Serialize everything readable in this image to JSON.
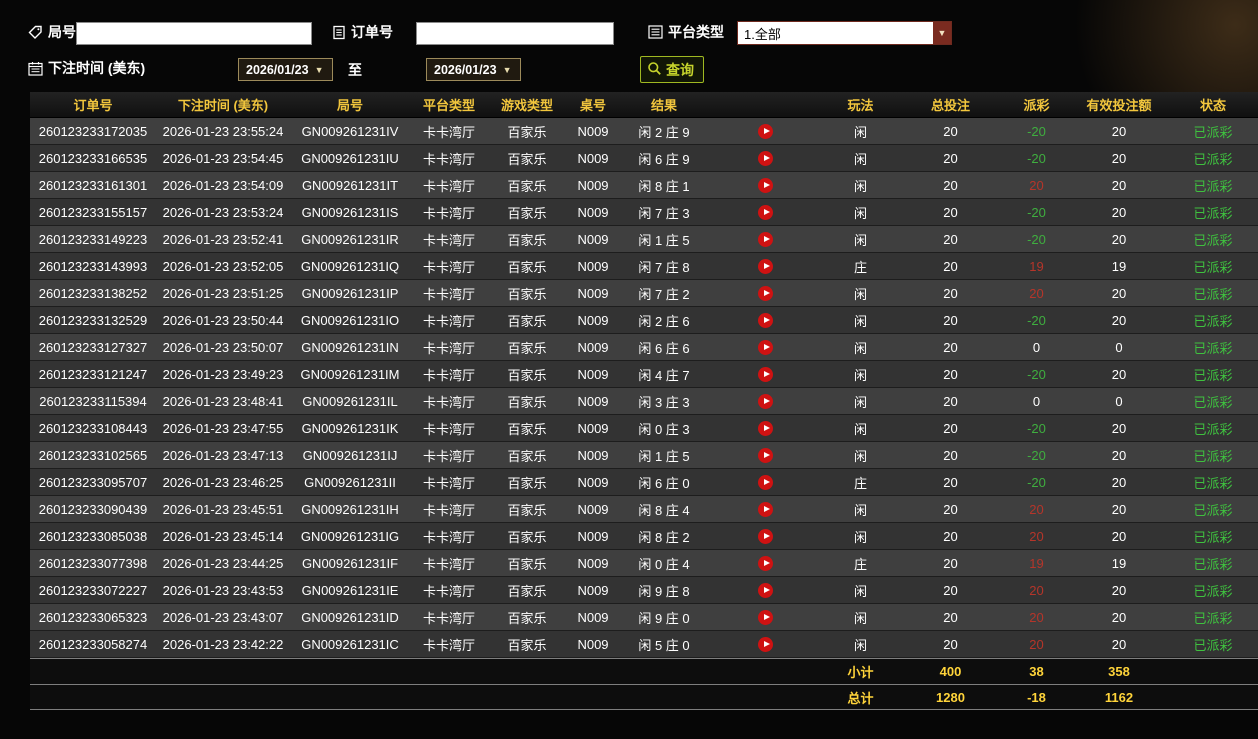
{
  "colors": {
    "header_text": "#f2c63d",
    "payout_win": "#b5352a",
    "payout_loss": "#3fae3f",
    "status_paid": "#3fc13f",
    "totals_text": "#ffd43a",
    "play_button": "#cf1212",
    "query_accent": "#c6d42c"
  },
  "icons": {
    "round": "tag-icon",
    "order": "document-icon",
    "platform": "list-icon",
    "bet_time": "calendar-icon",
    "query": "search-icon",
    "replay": "play-icon",
    "dropdown": "chevron-down-icon"
  },
  "filters": {
    "round": {
      "label": "局号",
      "value": ""
    },
    "order": {
      "label": "订单号",
      "value": ""
    },
    "platform": {
      "label": "平台类型",
      "value": "1.全部"
    },
    "bet_time": {
      "label": "下注时间 (美东)",
      "from": "2026/01/23",
      "to_label": "至",
      "to": "2026/01/23"
    },
    "query_label": "查询"
  },
  "table": {
    "headers": [
      "订单号",
      "下注时间 (美东)",
      "局号",
      "平台类型",
      "游戏类型",
      "桌号",
      "结果",
      "",
      "玩法",
      "总投注",
      "派彩",
      "有效投注额",
      "状态"
    ],
    "rows": [
      {
        "order_id": "260123233172035",
        "bet_time": "2026-01-23 23:55:24",
        "round": "GN009261231IV",
        "platform": "卡卡湾厅",
        "game": "百家乐",
        "table_no": "N009",
        "result": "闲 2 庄 9",
        "play": "闲",
        "total_bet": "20",
        "payout": "-20",
        "payout_class": "neg",
        "valid_bet": "20",
        "status": "已派彩"
      },
      {
        "order_id": "260123233166535",
        "bet_time": "2026-01-23 23:54:45",
        "round": "GN009261231IU",
        "platform": "卡卡湾厅",
        "game": "百家乐",
        "table_no": "N009",
        "result": "闲 6 庄 9",
        "play": "闲",
        "total_bet": "20",
        "payout": "-20",
        "payout_class": "neg",
        "valid_bet": "20",
        "status": "已派彩"
      },
      {
        "order_id": "260123233161301",
        "bet_time": "2026-01-23 23:54:09",
        "round": "GN009261231IT",
        "platform": "卡卡湾厅",
        "game": "百家乐",
        "table_no": "N009",
        "result": "闲 8 庄 1",
        "play": "闲",
        "total_bet": "20",
        "payout": "20",
        "payout_class": "pos",
        "valid_bet": "20",
        "status": "已派彩"
      },
      {
        "order_id": "260123233155157",
        "bet_time": "2026-01-23 23:53:24",
        "round": "GN009261231IS",
        "platform": "卡卡湾厅",
        "game": "百家乐",
        "table_no": "N009",
        "result": "闲 7 庄 3",
        "play": "闲",
        "total_bet": "20",
        "payout": "-20",
        "payout_class": "neg",
        "valid_bet": "20",
        "status": "已派彩"
      },
      {
        "order_id": "260123233149223",
        "bet_time": "2026-01-23 23:52:41",
        "round": "GN009261231IR",
        "platform": "卡卡湾厅",
        "game": "百家乐",
        "table_no": "N009",
        "result": "闲 1 庄 5",
        "play": "闲",
        "total_bet": "20",
        "payout": "-20",
        "payout_class": "neg",
        "valid_bet": "20",
        "status": "已派彩"
      },
      {
        "order_id": "260123233143993",
        "bet_time": "2026-01-23 23:52:05",
        "round": "GN009261231IQ",
        "platform": "卡卡湾厅",
        "game": "百家乐",
        "table_no": "N009",
        "result": "闲 7 庄 8",
        "play": "庄",
        "total_bet": "20",
        "payout": "19",
        "payout_class": "pos",
        "valid_bet": "19",
        "status": "已派彩"
      },
      {
        "order_id": "260123233138252",
        "bet_time": "2026-01-23 23:51:25",
        "round": "GN009261231IP",
        "platform": "卡卡湾厅",
        "game": "百家乐",
        "table_no": "N009",
        "result": "闲 7 庄 2",
        "play": "闲",
        "total_bet": "20",
        "payout": "20",
        "payout_class": "pos",
        "valid_bet": "20",
        "status": "已派彩"
      },
      {
        "order_id": "260123233132529",
        "bet_time": "2026-01-23 23:50:44",
        "round": "GN009261231IO",
        "platform": "卡卡湾厅",
        "game": "百家乐",
        "table_no": "N009",
        "result": "闲 2 庄 6",
        "play": "闲",
        "total_bet": "20",
        "payout": "-20",
        "payout_class": "neg",
        "valid_bet": "20",
        "status": "已派彩"
      },
      {
        "order_id": "260123233127327",
        "bet_time": "2026-01-23 23:50:07",
        "round": "GN009261231IN",
        "platform": "卡卡湾厅",
        "game": "百家乐",
        "table_no": "N009",
        "result": "闲 6 庄 6",
        "play": "闲",
        "total_bet": "20",
        "payout": "0",
        "payout_class": "zero",
        "valid_bet": "0",
        "status": "已派彩"
      },
      {
        "order_id": "260123233121247",
        "bet_time": "2026-01-23 23:49:23",
        "round": "GN009261231IM",
        "platform": "卡卡湾厅",
        "game": "百家乐",
        "table_no": "N009",
        "result": "闲 4 庄 7",
        "play": "闲",
        "total_bet": "20",
        "payout": "-20",
        "payout_class": "neg",
        "valid_bet": "20",
        "status": "已派彩"
      },
      {
        "order_id": "260123233115394",
        "bet_time": "2026-01-23 23:48:41",
        "round": "GN009261231IL",
        "platform": "卡卡湾厅",
        "game": "百家乐",
        "table_no": "N009",
        "result": "闲 3 庄 3",
        "play": "闲",
        "total_bet": "20",
        "payout": "0",
        "payout_class": "zero",
        "valid_bet": "0",
        "status": "已派彩"
      },
      {
        "order_id": "260123233108443",
        "bet_time": "2026-01-23 23:47:55",
        "round": "GN009261231IK",
        "platform": "卡卡湾厅",
        "game": "百家乐",
        "table_no": "N009",
        "result": "闲 0 庄 3",
        "play": "闲",
        "total_bet": "20",
        "payout": "-20",
        "payout_class": "neg",
        "valid_bet": "20",
        "status": "已派彩"
      },
      {
        "order_id": "260123233102565",
        "bet_time": "2026-01-23 23:47:13",
        "round": "GN009261231IJ",
        "platform": "卡卡湾厅",
        "game": "百家乐",
        "table_no": "N009",
        "result": "闲 1 庄 5",
        "play": "闲",
        "total_bet": "20",
        "payout": "-20",
        "payout_class": "neg",
        "valid_bet": "20",
        "status": "已派彩"
      },
      {
        "order_id": "260123233095707",
        "bet_time": "2026-01-23 23:46:25",
        "round": "GN009261231II",
        "platform": "卡卡湾厅",
        "game": "百家乐",
        "table_no": "N009",
        "result": "闲 6 庄 0",
        "play": "庄",
        "total_bet": "20",
        "payout": "-20",
        "payout_class": "neg",
        "valid_bet": "20",
        "status": "已派彩"
      },
      {
        "order_id": "260123233090439",
        "bet_time": "2026-01-23 23:45:51",
        "round": "GN009261231IH",
        "platform": "卡卡湾厅",
        "game": "百家乐",
        "table_no": "N009",
        "result": "闲 8 庄 4",
        "play": "闲",
        "total_bet": "20",
        "payout": "20",
        "payout_class": "pos",
        "valid_bet": "20",
        "status": "已派彩"
      },
      {
        "order_id": "260123233085038",
        "bet_time": "2026-01-23 23:45:14",
        "round": "GN009261231IG",
        "platform": "卡卡湾厅",
        "game": "百家乐",
        "table_no": "N009",
        "result": "闲 8 庄 2",
        "play": "闲",
        "total_bet": "20",
        "payout": "20",
        "payout_class": "pos",
        "valid_bet": "20",
        "status": "已派彩"
      },
      {
        "order_id": "260123233077398",
        "bet_time": "2026-01-23 23:44:25",
        "round": "GN009261231IF",
        "platform": "卡卡湾厅",
        "game": "百家乐",
        "table_no": "N009",
        "result": "闲 0 庄 4",
        "play": "庄",
        "total_bet": "20",
        "payout": "19",
        "payout_class": "pos",
        "valid_bet": "19",
        "status": "已派彩"
      },
      {
        "order_id": "260123233072227",
        "bet_time": "2026-01-23 23:43:53",
        "round": "GN009261231IE",
        "platform": "卡卡湾厅",
        "game": "百家乐",
        "table_no": "N009",
        "result": "闲 9 庄 8",
        "play": "闲",
        "total_bet": "20",
        "payout": "20",
        "payout_class": "pos",
        "valid_bet": "20",
        "status": "已派彩"
      },
      {
        "order_id": "260123233065323",
        "bet_time": "2026-01-23 23:43:07",
        "round": "GN009261231ID",
        "platform": "卡卡湾厅",
        "game": "百家乐",
        "table_no": "N009",
        "result": "闲 9 庄 0",
        "play": "闲",
        "total_bet": "20",
        "payout": "20",
        "payout_class": "pos",
        "valid_bet": "20",
        "status": "已派彩"
      },
      {
        "order_id": "260123233058274",
        "bet_time": "2026-01-23 23:42:22",
        "round": "GN009261231IC",
        "platform": "卡卡湾厅",
        "game": "百家乐",
        "table_no": "N009",
        "result": "闲 5 庄 0",
        "play": "闲",
        "total_bet": "20",
        "payout": "20",
        "payout_class": "pos",
        "valid_bet": "20",
        "status": "已派彩"
      }
    ],
    "subtotal": {
      "label": "小计",
      "total_bet": "400",
      "payout": "38",
      "valid_bet": "358"
    },
    "total": {
      "label": "总计",
      "total_bet": "1280",
      "payout": "-18",
      "valid_bet": "1162"
    }
  }
}
